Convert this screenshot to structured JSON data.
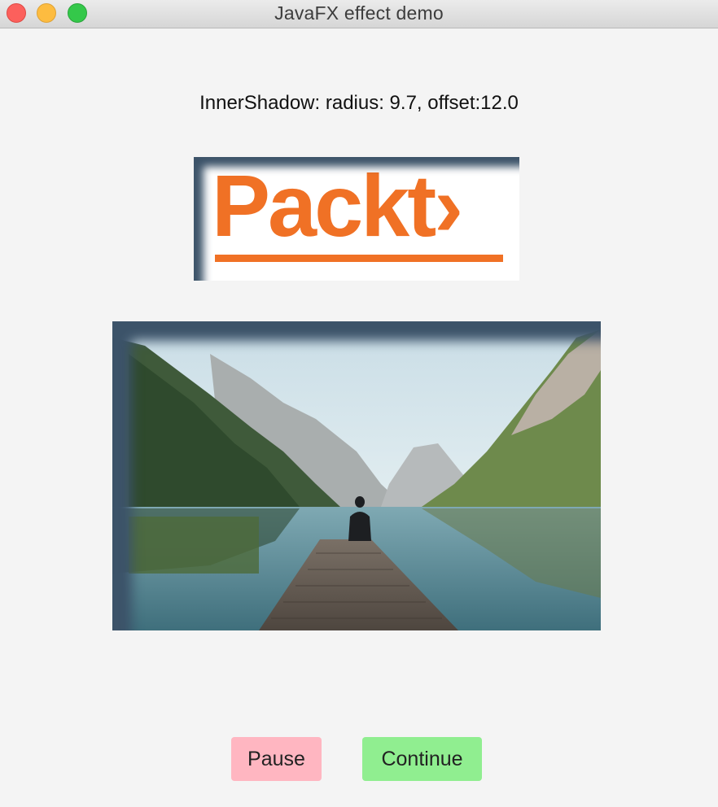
{
  "window": {
    "title": "JavaFX effect demo",
    "traffic_lights": {
      "close": "#fc605c",
      "minimize": "#fdbc40",
      "maximize": "#34c84a"
    }
  },
  "caption": "InnerShadow: radius: 9.7, offset:12.0",
  "logo": {
    "text": "Packt",
    "arrow": "›",
    "brand_color": "#f07125"
  },
  "shadow_color": "#3c5369",
  "buttons": {
    "pause": {
      "label": "Pause",
      "color": "#ffb6c1"
    },
    "continue": {
      "label": "Continue",
      "color": "#90ee90"
    }
  }
}
